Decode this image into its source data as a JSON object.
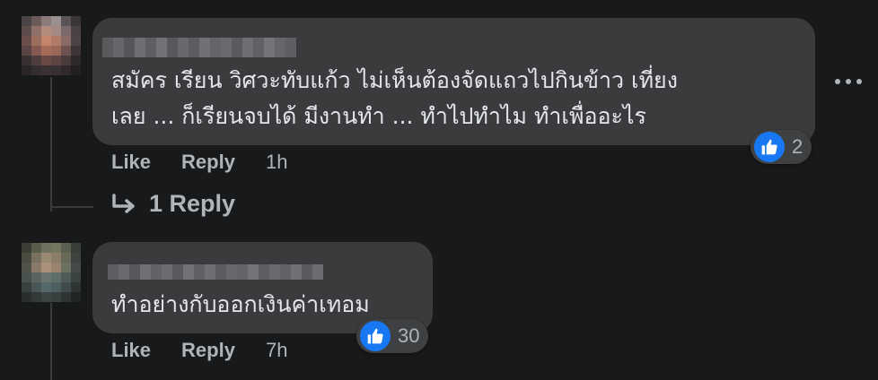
{
  "comments": [
    {
      "text_lines": [
        "สมัคร เรียน วิศวะทับแก้ว ไม่เห็นต้องจัดแถวไปกินข้าว เที่ยง",
        "เลย ... ก็เรียนจบได้ มีงานทำ ... ทำไปทำไม ทำเพื่ออะไร"
      ],
      "reaction_count": "2",
      "actions": {
        "like": "Like",
        "reply": "Reply"
      },
      "timestamp": "1h"
    },
    {
      "text_lines": [
        "ทำอย่างกับออกเงินค่าเทอม"
      ],
      "reaction_count": "30",
      "actions": {
        "like": "Like",
        "reply": "Reply"
      },
      "timestamp": "7h"
    }
  ],
  "replies_link": {
    "label": "1 Reply"
  },
  "icons": {
    "reaction": "like-icon",
    "more": "more-options-icon",
    "reply_arrow": "reply-arrow-icon"
  },
  "colors": {
    "background": "#18191a",
    "bubble": "#3a3b3c",
    "text": "#e4e6eb",
    "secondary_text": "#b0b3b8",
    "like_blue": "#1877f2"
  }
}
